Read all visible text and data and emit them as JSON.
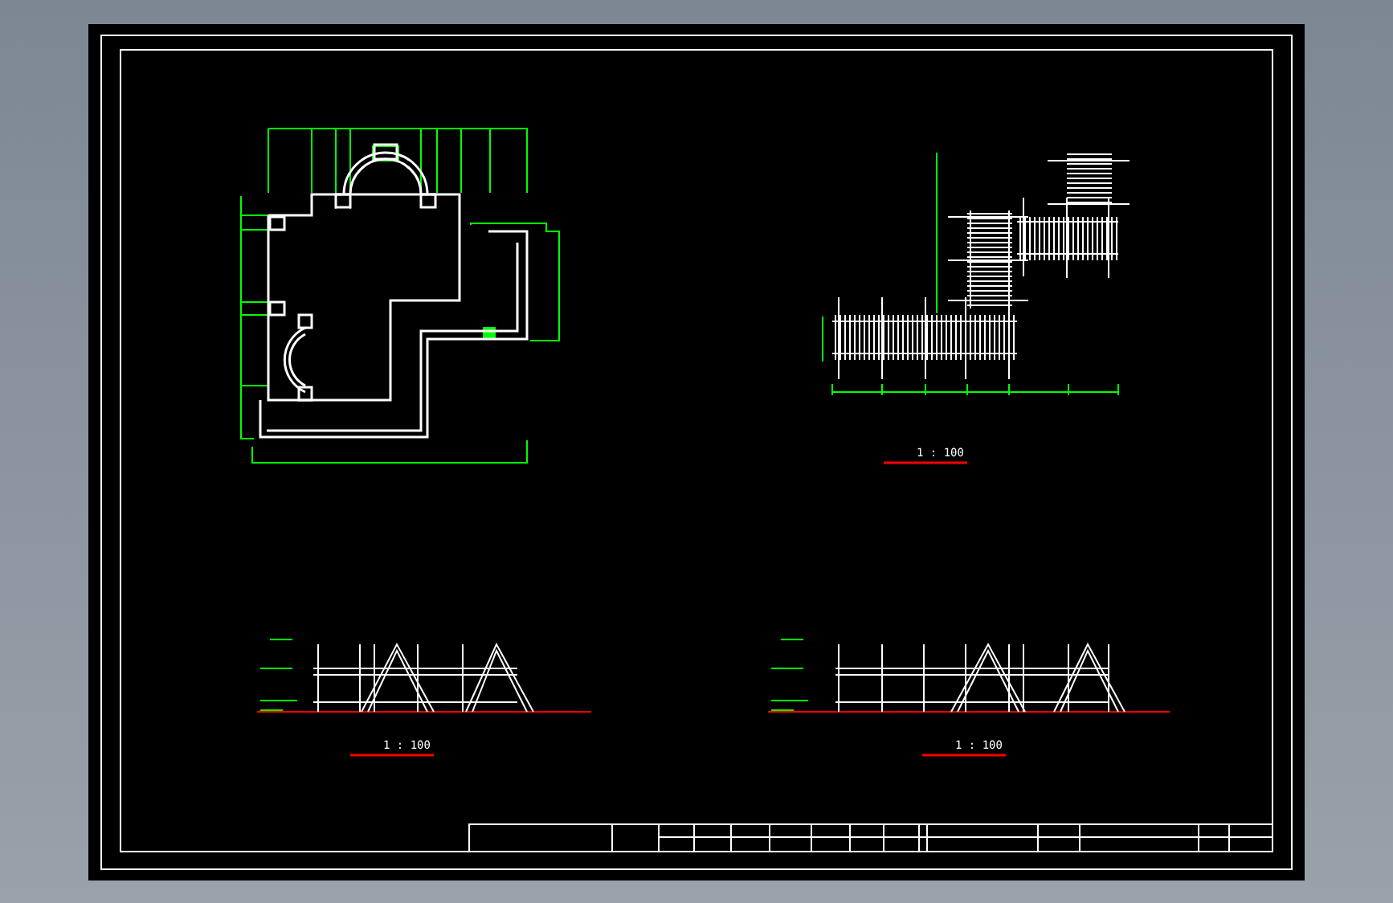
{
  "drawings": [
    {
      "kind": "site-plan"
    },
    {
      "kind": "pergola-plan",
      "scale": "1 : 100"
    },
    {
      "kind": "elevation",
      "scale": "1 : 100"
    },
    {
      "kind": "elevation",
      "scale": "1 : 100"
    }
  ]
}
